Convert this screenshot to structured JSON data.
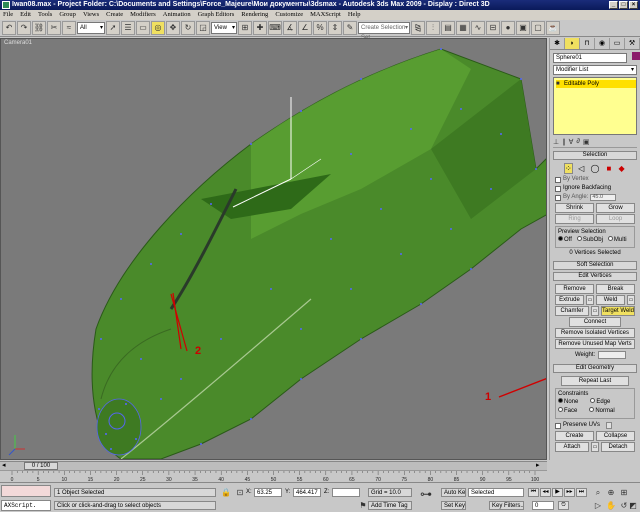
{
  "window": {
    "title": "Iwan08.max - Project Folder: C:\\Documents and Settings\\Force_Majeure\\Мои документы\\3dsmax - Autodesk 3ds Max 2009 - Display : Direct 3D"
  },
  "menu": [
    "File",
    "Edit",
    "Tools",
    "Group",
    "Views",
    "Create",
    "Modifiers",
    "Animation",
    "Graph Editors",
    "Rendering",
    "Customize",
    "MAXScript",
    "Help"
  ],
  "toolbar": {
    "filter_value": "All",
    "refcoord_value": "View",
    "named_selection_placeholder": "Create Selection Set"
  },
  "viewport": {
    "label": "Camera01",
    "annotations": [
      "1",
      "2"
    ]
  },
  "command_panel": {
    "object_name": "Sphere01",
    "modifier_list": "Modifier List",
    "stack_item": "Editable Poly",
    "selection": {
      "title": "Selection",
      "by_vertex": "By Vertex",
      "ignore_backfacing": "Ignore Backfacing",
      "by_angle": "By Angle:",
      "angle_value": "45.0",
      "shrink": "Shrink",
      "grow": "Grow",
      "ring": "Ring",
      "loop": "Loop",
      "preview_title": "Preview Selection",
      "preview_options": [
        "Off",
        "SubObj",
        "Multi"
      ],
      "status": "0 Vertices Selected"
    },
    "soft_selection_title": "Soft Selection",
    "edit_vertices": {
      "title": "Edit Vertices",
      "remove": "Remove",
      "break": "Break",
      "extrude": "Extrude",
      "weld": "Weld",
      "chamfer": "Chamfer",
      "target_weld": "Target Weld",
      "connect": "Connect",
      "remove_isolated": "Remove Isolated Vertices",
      "remove_unused": "Remove Unused Map Verts",
      "weight_label": "Weight:"
    },
    "edit_geometry": {
      "title": "Edit Geometry",
      "repeat_last": "Repeat Last",
      "constraints_title": "Constraints",
      "constraints": [
        "None",
        "Edge",
        "Face",
        "Normal"
      ],
      "preserve_uvs": "Preserve UVs",
      "create": "Create",
      "collapse": "Collapse",
      "attach": "Attach",
      "detach": "Detach"
    }
  },
  "timeline": {
    "slider_label": "0 / 100",
    "ticks": [
      "0",
      "5",
      "10",
      "15",
      "20",
      "25",
      "30",
      "35",
      "40",
      "45",
      "50",
      "55",
      "60",
      "65",
      "70",
      "75",
      "80",
      "85",
      "90",
      "95",
      "100"
    ]
  },
  "status": {
    "script_listener": "AXScript.",
    "selected_text": "1 Object Selected",
    "prompt": "Click or click-and-drag to select objects",
    "x_label": "X:",
    "x_value": "63.25",
    "y_label": "Y:",
    "y_value": "464.417",
    "z_label": "Z:",
    "grid": "Grid = 10.0",
    "add_time_tag": "Add Time Tag",
    "auto_key": "Auto Key",
    "set_key": "Set Key",
    "selected_dropdown": "Selected",
    "key_filters": "Key Filters...",
    "frame_value": "0"
  }
}
